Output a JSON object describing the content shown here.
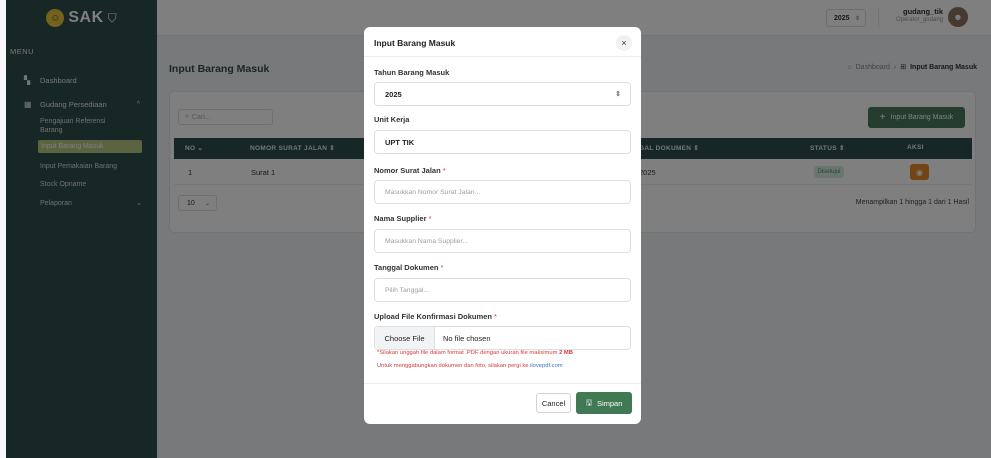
{
  "app": {
    "brand": "SAK",
    "brand_mark": "⛉"
  },
  "sidebar": {
    "menu_title": "MENU",
    "items": [
      {
        "label": "Dashboard",
        "icon": "dashboard-icon"
      },
      {
        "label": "Gudang Persediaan",
        "icon": "warehouse-icon"
      },
      {
        "label": "Pengajuan Referensi Barang"
      },
      {
        "label": "Input Barang Masuk"
      },
      {
        "label": "Input Pemakaian Barang"
      },
      {
        "label": "Stock Opname"
      },
      {
        "label": "Pelaporan"
      }
    ]
  },
  "topbar": {
    "year": "2025",
    "user_name": "gudang_tik",
    "user_role": "Operator_gudang"
  },
  "page": {
    "title": "Input Barang Masuk",
    "breadcrumb_home": "Dashboard",
    "breadcrumb_current": "Input Barang Masuk",
    "search_placeholder": "Cari...",
    "add_button": "Input Barang Masuk",
    "columns": [
      "NO",
      "NOMOR SURAT JALAN",
      "GAL DOKUMEN",
      "STATUS",
      "AKSI"
    ],
    "rows": [
      {
        "no": "1",
        "surat_jalan": "Surat 1",
        "tanggal": "2025",
        "status": "Disetujui"
      }
    ],
    "per_page": "10",
    "page_info": "Menampilkan 1 hingga 1 dari 1 Hasil"
  },
  "modal": {
    "title": "Input Barang Masuk",
    "close": "×",
    "tahun_label": "Tahun Barang Masuk",
    "tahun_value": "2025",
    "unit_label": "Unit Kerja",
    "unit_value": "UPT TIK",
    "surat_label": "Nomor Surat Jalan",
    "surat_placeholder": "Masukkan Nomor Surat Jalan...",
    "supplier_label": "Nama Supplier",
    "supplier_placeholder": "Masukkan Nama Supplier...",
    "tanggal_label": "Tanggal Dokumen",
    "tanggal_placeholder": "Pilih Tanggal...",
    "upload_label": "Upload File Konfirmasi Dokumen",
    "file_button": "Choose File",
    "file_status": "No file chosen",
    "hint1_prefix": "*Silakan unggah file dalam format .PDF dengan ukuran file maksimum",
    "hint1_size": "2 MB",
    "hint2_prefix": "Untuk menggabungkan dokumen dan foto, silakan pergi ke",
    "hint2_link": "ilovepdf.com",
    "required_mark": "*",
    "cancel": "Cancel",
    "save": "Simpan"
  }
}
